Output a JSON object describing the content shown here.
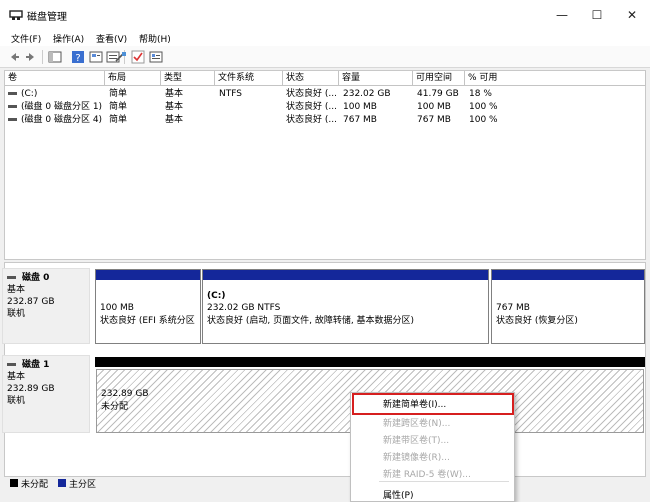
{
  "window": {
    "title": "磁盘管理",
    "buttons": [
      "—",
      "☐",
      "✕"
    ]
  },
  "menu": [
    "文件(F)",
    "操作(A)",
    "查看(V)",
    "帮助(H)"
  ],
  "columns": [
    "卷",
    "布局",
    "类型",
    "文件系统",
    "状态",
    "容量",
    "可用空间",
    "% 可用"
  ],
  "volumes": [
    {
      "name": "(C:)",
      "layout": "简单",
      "type": "基本",
      "fs": "NTFS",
      "status": "状态良好 (...",
      "capacity": "232.02 GB",
      "free": "41.79 GB",
      "pct": "18 %"
    },
    {
      "name": "(磁盘 0 磁盘分区 1)",
      "layout": "简单",
      "type": "基本",
      "fs": "",
      "status": "状态良好 (...",
      "capacity": "100 MB",
      "free": "100 MB",
      "pct": "100 %"
    },
    {
      "name": "(磁盘 0 磁盘分区 4)",
      "layout": "简单",
      "type": "基本",
      "fs": "",
      "status": "状态良好 (...",
      "capacity": "767 MB",
      "free": "767 MB",
      "pct": "100 %"
    }
  ],
  "disks": [
    {
      "name": "磁盘 0",
      "kind": "基本",
      "size": "232.87 GB",
      "state": "联机",
      "partitions": [
        {
          "title": "",
          "size": "100 MB",
          "status": "状态良好 (EFI 系统分区"
        },
        {
          "title": "(C:)",
          "size": "232.02 GB NTFS",
          "status": "状态良好 (启动, 页面文件, 故障转储, 基本数据分区)"
        },
        {
          "title": "",
          "size": "767 MB",
          "status": "状态良好 (恢复分区)"
        }
      ]
    },
    {
      "name": "磁盘 1",
      "kind": "基本",
      "size": "232.89 GB",
      "state": "联机",
      "unallocated": {
        "size": "232.89 GB",
        "label": "未分配"
      }
    }
  ],
  "legend": [
    {
      "label": "未分配",
      "color": "#000000"
    },
    {
      "label": "主分区",
      "color": "#14279a"
    }
  ],
  "context_menu": [
    {
      "label": "新建简单卷(I)...",
      "enabled": true,
      "highlighted": true
    },
    {
      "label": "新建跨区卷(N)...",
      "enabled": false
    },
    {
      "label": "新建带区卷(T)...",
      "enabled": false
    },
    {
      "label": "新建镜像卷(R)...",
      "enabled": false
    },
    {
      "label": "新建 RAID-5 卷(W)...",
      "enabled": false
    },
    {
      "label": "属性(P)",
      "enabled": true
    }
  ],
  "colors": {
    "primary_partition": "#14279a",
    "unallocated": "#000000",
    "highlight_border": "#d61f1f"
  },
  "icons": {
    "toolbar": [
      "back-icon",
      "forward-icon",
      "console-tree-icon",
      "help-icon",
      "properties-icon",
      "connect-icon",
      "check-icon",
      "list-icon"
    ]
  }
}
